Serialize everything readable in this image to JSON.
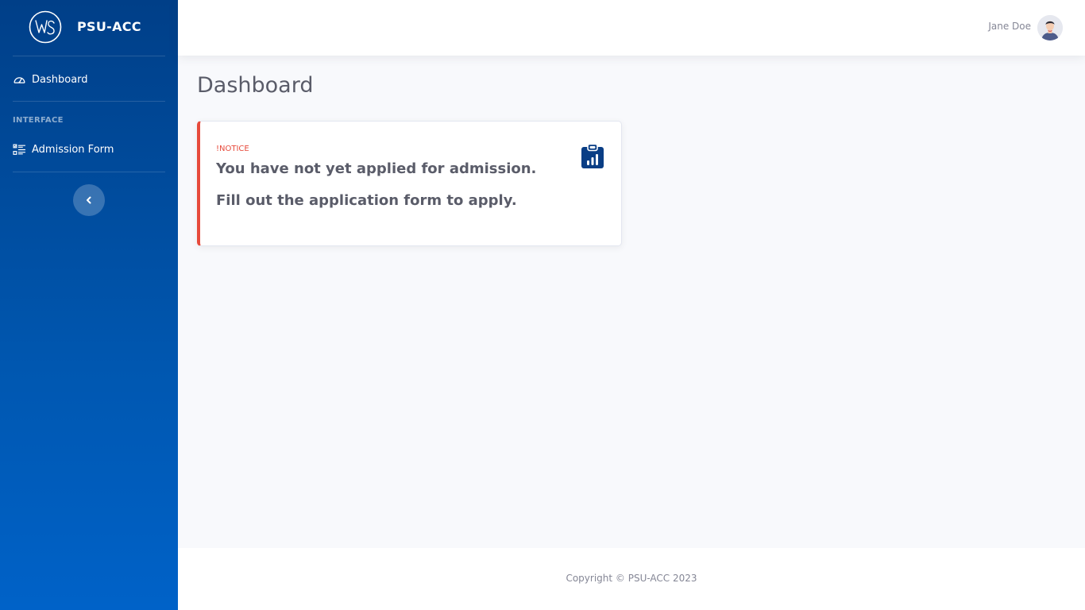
{
  "sidebar": {
    "brand": {
      "name": "PSU-ACC",
      "logo_text": "WS"
    },
    "items": [
      {
        "label": "Dashboard",
        "icon": "dashboard-gauge-icon"
      },
      {
        "label": "Admission Form",
        "icon": "list-check-icon"
      }
    ],
    "section_heading": "INTERFACE",
    "toggle_icon": "chevron-left-icon"
  },
  "topbar": {
    "user_name": "Jane Doe",
    "avatar_icon": "user-avatar-icon"
  },
  "main": {
    "page_title": "Dashboard",
    "notice_card": {
      "label": "!NOTICE",
      "line1": "You have not yet applied for admission.",
      "line2": "Fill out the application form to apply.",
      "icon": "clipboard-chart-icon"
    }
  },
  "footer": {
    "copyright": "Copyright © PSU-ACC 2023"
  },
  "colors": {
    "sidebar_top": "#003f88",
    "sidebar_bottom": "#0062c8",
    "notice_accent": "#e74a3b",
    "icon_blue": "#0a3e85",
    "text_gray": "#5a5c69"
  }
}
